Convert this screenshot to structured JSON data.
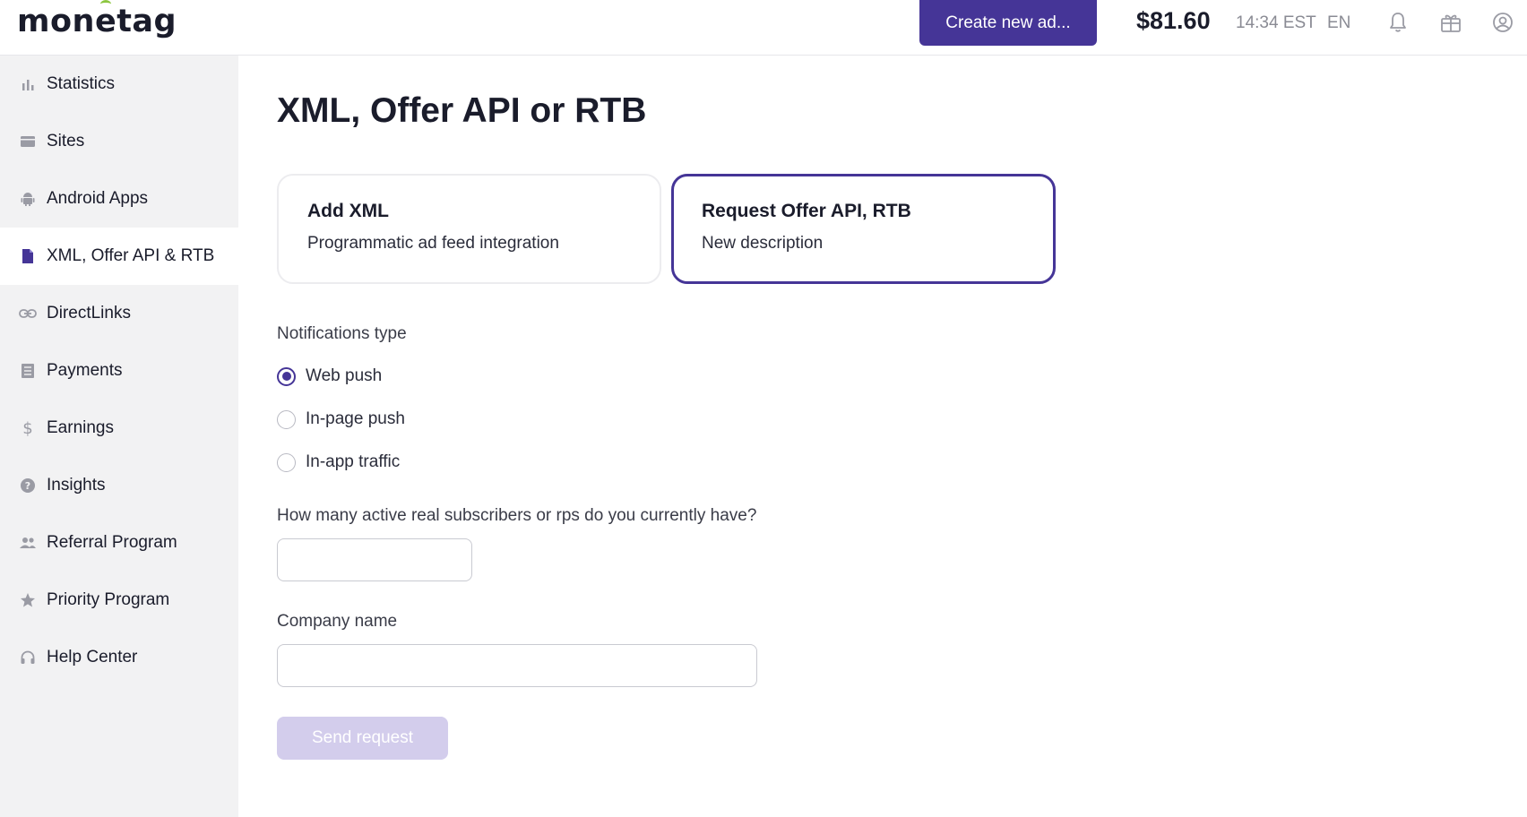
{
  "header": {
    "logo": {
      "pre": "mon",
      "accent": "e",
      "post": "tag"
    },
    "create_button": "Create new ad...",
    "balance": "$81.60",
    "time": "14:34 EST",
    "language": "EN",
    "icons": [
      "bell-icon",
      "gift-icon",
      "user-icon"
    ]
  },
  "sidebar": {
    "items": [
      {
        "label": "Statistics",
        "icon": "bar-chart-icon"
      },
      {
        "label": "Sites",
        "icon": "browser-icon"
      },
      {
        "label": "Android Apps",
        "icon": "android-icon"
      },
      {
        "label": "XML, Offer API & RTB",
        "icon": "document-icon",
        "active": true
      },
      {
        "label": "DirectLinks",
        "icon": "link-icon"
      },
      {
        "label": "Payments",
        "icon": "receipt-icon"
      },
      {
        "label": "Earnings",
        "icon": "dollar-icon"
      },
      {
        "label": "Insights",
        "icon": "help-circle-icon"
      },
      {
        "label": "Referral Program",
        "icon": "people-icon"
      },
      {
        "label": "Priority Program",
        "icon": "star-icon"
      },
      {
        "label": "Help Center",
        "icon": "headset-icon"
      }
    ]
  },
  "main": {
    "title": "XML, Offer API or RTB",
    "cards": [
      {
        "title": "Add XML",
        "description": "Programmatic ad feed integration",
        "selected": false
      },
      {
        "title": "Request Offer API, RTB",
        "description": "New description",
        "selected": true
      }
    ],
    "notifications": {
      "label": "Notifications type",
      "options": [
        {
          "label": "Web push",
          "checked": true
        },
        {
          "label": "In-page push",
          "checked": false
        },
        {
          "label": "In-app traffic",
          "checked": false
        }
      ]
    },
    "subscribers": {
      "label": "How many active real subscribers or rps do you currently have?",
      "value": ""
    },
    "company": {
      "label": "Company name",
      "value": ""
    },
    "send_button": "Send request"
  },
  "colors": {
    "accent": "#453597",
    "accent_disabled": "#d3cdec",
    "logo_green": "#8cc63f",
    "sidebar_bg": "#f2f2f3"
  }
}
